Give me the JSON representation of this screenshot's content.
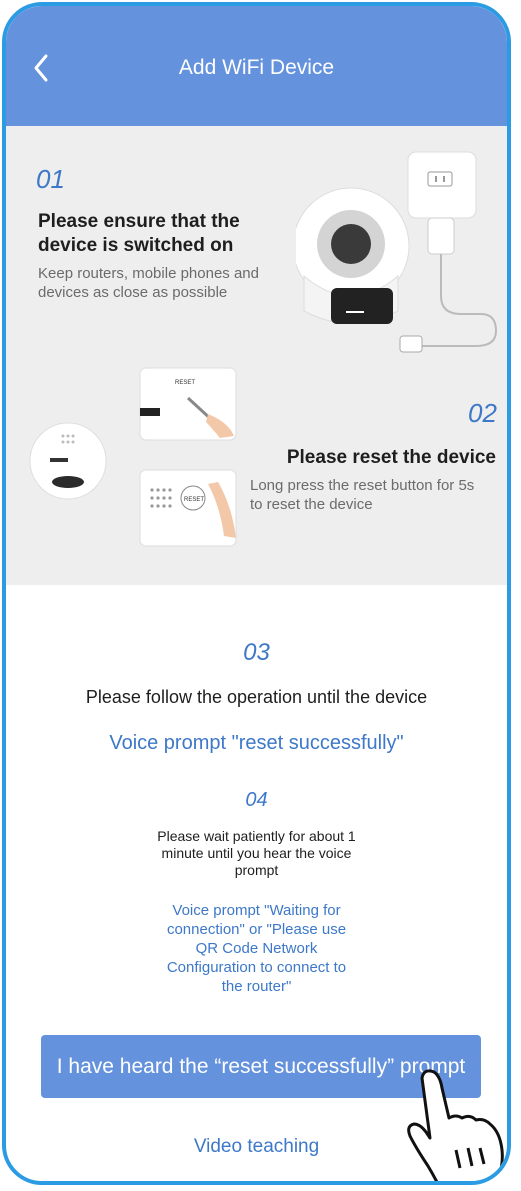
{
  "header": {
    "title": "Add WiFi Device"
  },
  "step1": {
    "number": "01",
    "title": "Please ensure that the device is switched on",
    "desc": "Keep routers, mobile phones and devices as close as possible"
  },
  "step2": {
    "number": "02",
    "title": "Please reset the device",
    "desc": "Long press the reset button for 5s to reset the device",
    "reset_label": "RESET"
  },
  "step3": {
    "number": "03",
    "instruction": "Please follow the operation until the device",
    "prompt": "Voice prompt \"reset successfully\""
  },
  "step4": {
    "number": "04",
    "instruction": "Please wait patiently for about 1 minute until you hear the voice prompt",
    "prompt": "Voice prompt \"Waiting for connection\" or \"Please use QR Code Network Configuration to connect to the router\""
  },
  "actions": {
    "confirm_button": "I have heard the “reset successfully” prompt",
    "video_link": "Video teaching"
  },
  "colors": {
    "accent": "#6492dd",
    "link": "#3d78c9",
    "frame": "#2b9be3"
  }
}
